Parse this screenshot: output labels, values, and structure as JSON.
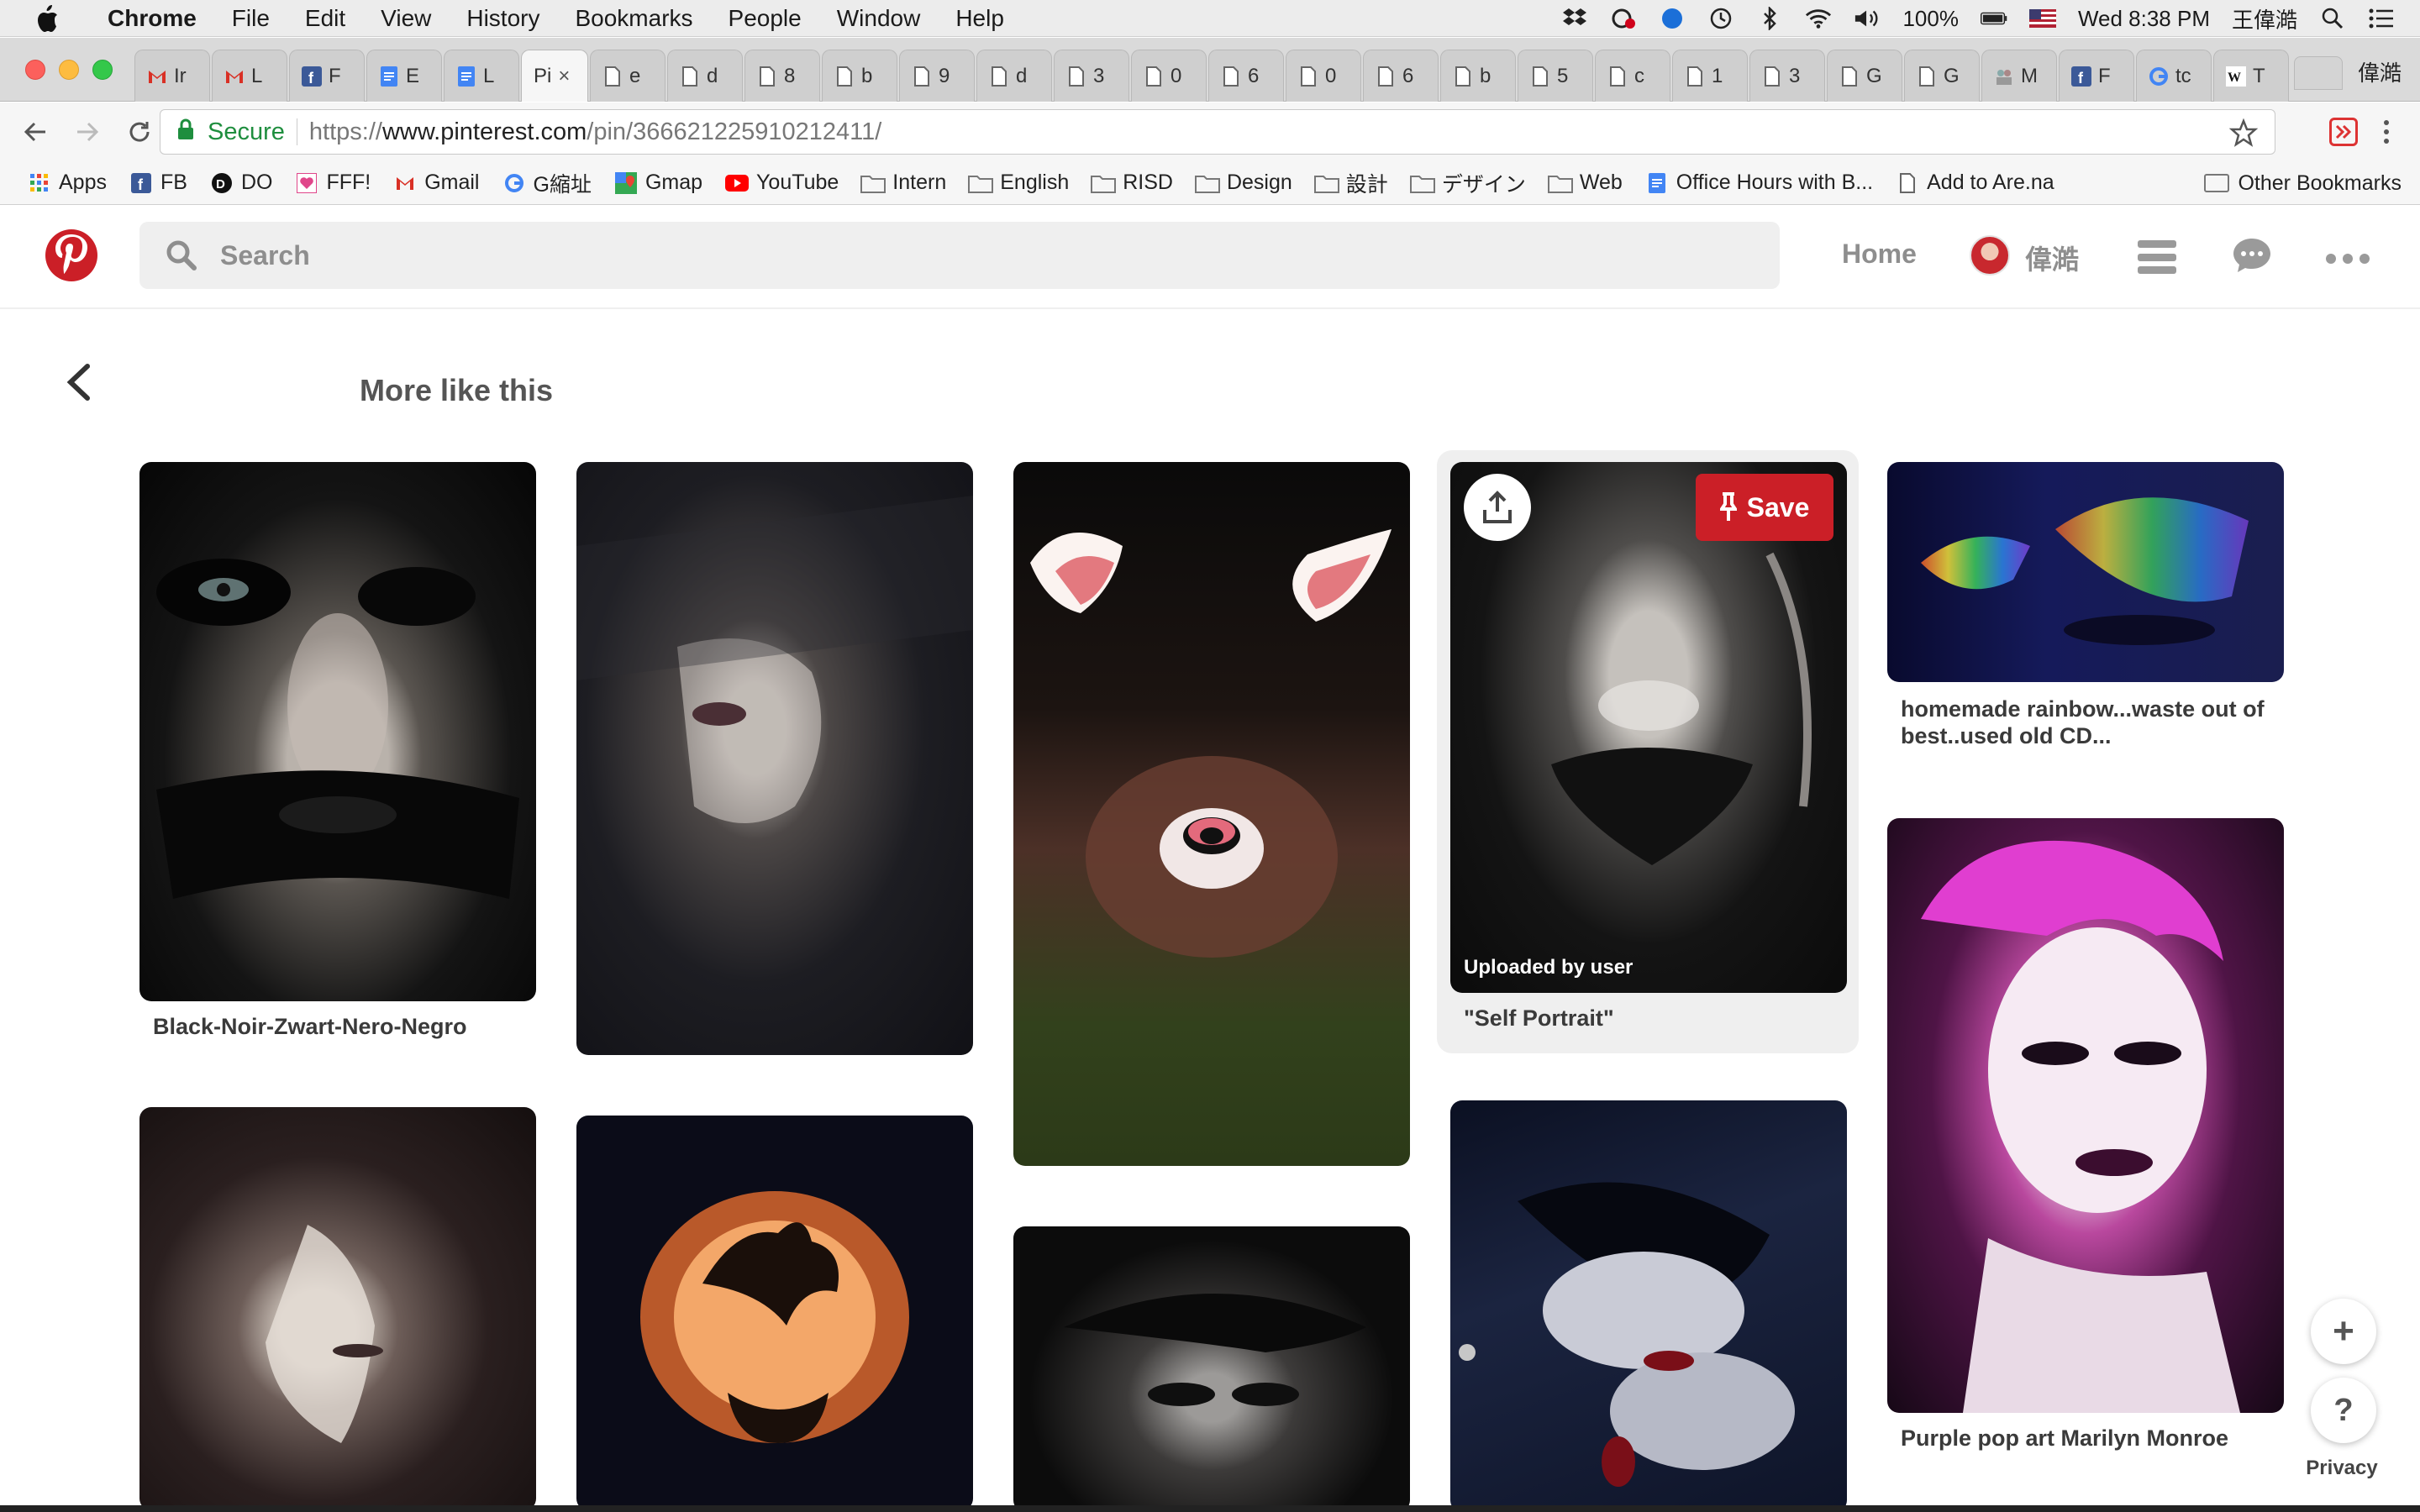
{
  "menubar": {
    "app_name": "Chrome",
    "items": [
      "File",
      "Edit",
      "View",
      "History",
      "Bookmarks",
      "People",
      "Window",
      "Help"
    ],
    "battery": "100%",
    "clock": "Wed 8:38 PM",
    "user": "王偉澔"
  },
  "tabs": {
    "items": [
      {
        "icon": "gmail-icon",
        "label": "Ir"
      },
      {
        "icon": "gmail-icon",
        "label": "L"
      },
      {
        "icon": "facebook-icon",
        "label": "F"
      },
      {
        "icon": "docs-icon",
        "label": "E"
      },
      {
        "icon": "docs-icon",
        "label": "L"
      },
      {
        "icon": "none",
        "label": "Pi"
      },
      {
        "icon": "page-icon",
        "label": "e"
      },
      {
        "icon": "page-icon",
        "label": "d"
      },
      {
        "icon": "page-icon",
        "label": "8"
      },
      {
        "icon": "page-icon",
        "label": "b"
      },
      {
        "icon": "page-icon",
        "label": "9"
      },
      {
        "icon": "page-icon",
        "label": "d"
      },
      {
        "icon": "page-icon",
        "label": "3"
      },
      {
        "icon": "page-icon",
        "label": "0"
      },
      {
        "icon": "page-icon",
        "label": "6"
      },
      {
        "icon": "page-icon",
        "label": "0"
      },
      {
        "icon": "page-icon",
        "label": "6"
      },
      {
        "icon": "page-icon",
        "label": "b"
      },
      {
        "icon": "page-icon",
        "label": "5"
      },
      {
        "icon": "page-icon",
        "label": "c"
      },
      {
        "icon": "page-icon",
        "label": "1"
      },
      {
        "icon": "page-icon",
        "label": "3"
      },
      {
        "icon": "page-icon",
        "label": "G"
      },
      {
        "icon": "page-icon",
        "label": "G"
      },
      {
        "icon": "people-icon",
        "label": "M"
      },
      {
        "icon": "facebook-icon",
        "label": "F"
      },
      {
        "icon": "google-icon",
        "label": "tc"
      },
      {
        "icon": "wikipedia-icon",
        "label": "T"
      }
    ],
    "active_index": 5,
    "profile_name": "偉澔"
  },
  "omnibox": {
    "secure_label": "Secure",
    "url_scheme": "https://",
    "url_host": "www.pinterest.com",
    "url_path": "/pin/366621225910212411/"
  },
  "bookmarks": [
    {
      "icon": "apps-icon",
      "label": "Apps"
    },
    {
      "icon": "facebook-icon",
      "label": "FB"
    },
    {
      "icon": "do-icon",
      "label": "DO"
    },
    {
      "icon": "heart-icon",
      "label": "FFF!"
    },
    {
      "icon": "gmail-icon",
      "label": "Gmail"
    },
    {
      "icon": "google-icon",
      "label": "G縮址"
    },
    {
      "icon": "maps-icon",
      "label": "Gmap"
    },
    {
      "icon": "youtube-icon",
      "label": "YouTube"
    },
    {
      "icon": "folder-icon",
      "label": "Intern"
    },
    {
      "icon": "folder-icon",
      "label": "English"
    },
    {
      "icon": "folder-icon",
      "label": "RISD"
    },
    {
      "icon": "folder-icon",
      "label": "Design"
    },
    {
      "icon": "folder-icon",
      "label": "設計"
    },
    {
      "icon": "folder-icon",
      "label": "デザイン"
    },
    {
      "icon": "folder-icon",
      "label": "Web"
    },
    {
      "icon": "docs-icon",
      "label": "Office Hours with B..."
    },
    {
      "icon": "page-icon",
      "label": "Add to Are.na"
    }
  ],
  "other_bookmarks": "Other Bookmarks",
  "pinterest": {
    "search_placeholder": "Search",
    "home": "Home",
    "user": "偉澔",
    "section_title": "More like this",
    "pins": [
      {
        "caption": "Black-Noir-Zwart-Nero-Negro"
      },
      {
        "caption": ""
      },
      {
        "caption": ""
      },
      {
        "caption": "\"Self Portrait\"",
        "overlay": "Uploaded by user",
        "save": "Save"
      },
      {
        "caption": "homemade rainbow...waste out of best..used old CD..."
      },
      {
        "caption": "Purple pop art Marilyn Monroe"
      }
    ],
    "privacy": "Privacy",
    "add_symbol": "+",
    "help_symbol": "?"
  },
  "colors": {
    "pinterest_red": "#cb1f27",
    "secure_green": "#1e8e3e"
  }
}
